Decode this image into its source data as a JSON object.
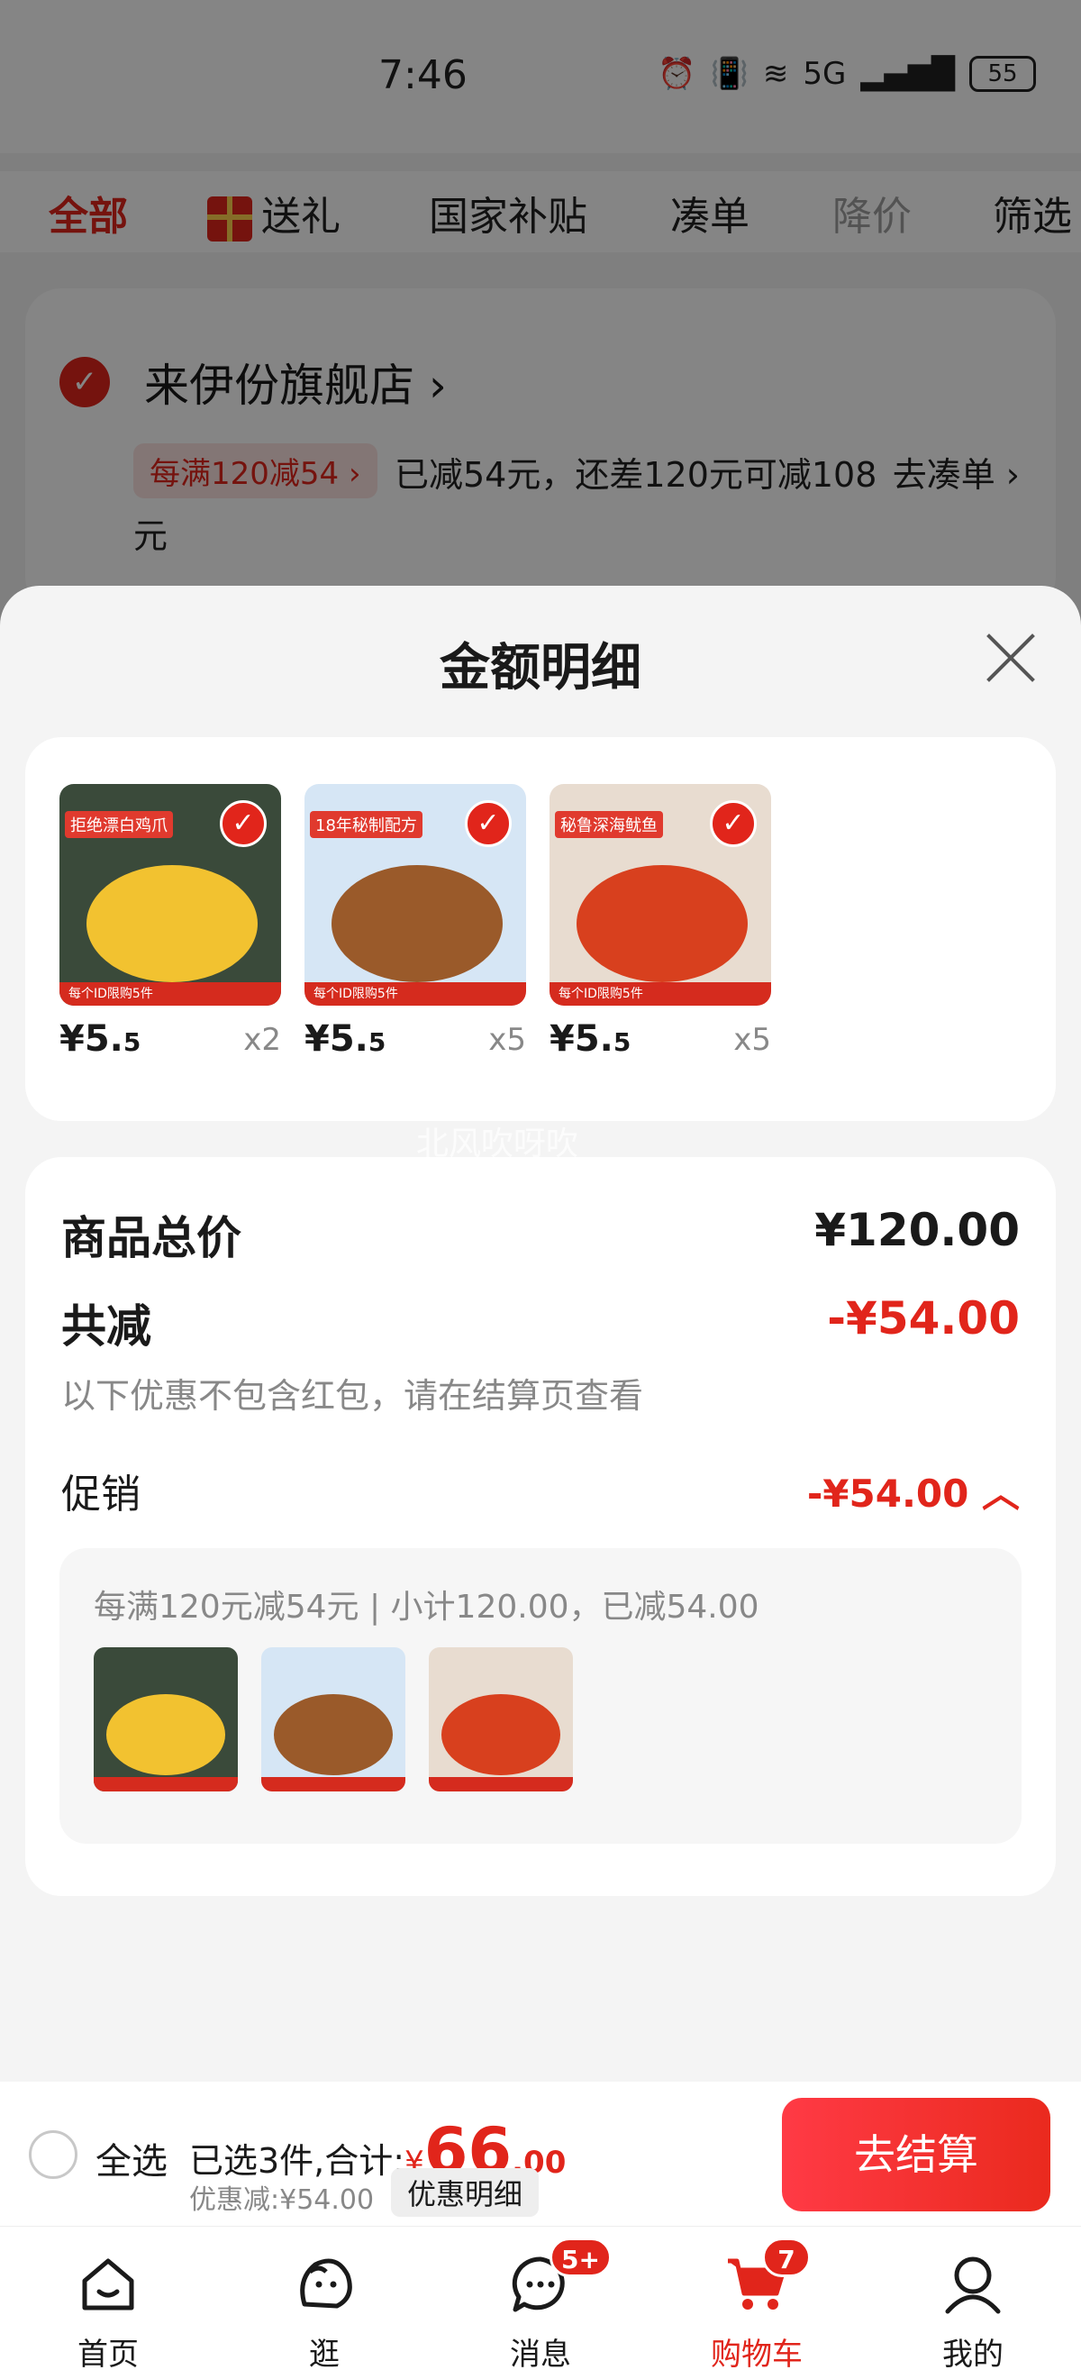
{
  "status_bar": {
    "time": "7:46",
    "network": "5G",
    "battery": "55"
  },
  "filter_tabs": {
    "all": "全部",
    "gift": "送礼",
    "subsidy": "国家补贴",
    "combine": "凑单",
    "price_drop": "降价",
    "filter": "筛选"
  },
  "store": {
    "name": "来伊份旗舰店",
    "name_arrow": "›",
    "promo_chip": "每满120减54 ›",
    "promo_text": "已减54元，还差120元可减108",
    "promo_go": "去凑单 ›",
    "promo_text_tail": "元"
  },
  "sheet": {
    "title": "金额明细",
    "products": [
      {
        "title": "拒绝漂白鸡爪",
        "banner": "每个ID限购5件",
        "price_main": "¥5.",
        "price_dec": "5",
        "qty": "x2"
      },
      {
        "title": "18年秘制配方",
        "banner": "每个ID限购5件",
        "price_main": "¥5.",
        "price_dec": "5",
        "qty": "x5"
      },
      {
        "title": "秘鲁深海鱿鱼",
        "banner": "每个ID限购5件",
        "price_main": "¥5.",
        "price_dec": "5",
        "qty": "x5"
      }
    ],
    "watermark": "北风吹呀吹",
    "summary": {
      "total_label": "商品总价",
      "total_value": "¥120.00",
      "reduce_label": "共减",
      "reduce_value": "-¥54.00",
      "reduce_note": "以下优惠不包含红包，请在结算页查看",
      "promo_label": "促销",
      "promo_value": "-¥54.00 ︿",
      "promo_detail": "每满120元减54元 | 小计120.00，已减54.00"
    }
  },
  "bottom_bar": {
    "select_all": "全选",
    "selected_prefix": "已选3件,合计:",
    "currency": "¥",
    "total_int": "66",
    "total_dec": ".00",
    "discount": "优惠减:¥54.00",
    "detail_chip": "优惠明细",
    "checkout": "去结算"
  },
  "nav": {
    "items": [
      {
        "label": "首页",
        "icon": "home-icon"
      },
      {
        "label": "逛",
        "icon": "browse-icon"
      },
      {
        "label": "消息",
        "icon": "message-icon",
        "badge": "5+"
      },
      {
        "label": "购物车",
        "icon": "cart-icon",
        "badge": "7"
      },
      {
        "label": "我的",
        "icon": "profile-icon"
      }
    ]
  },
  "colors": {
    "accent": "#e1251b",
    "overlay": "rgba(0,0,0,0.48)"
  }
}
